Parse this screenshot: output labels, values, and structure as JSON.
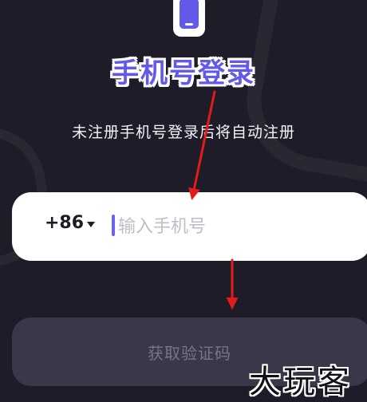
{
  "header": {
    "icon": "phone-icon",
    "title": "手机号登录",
    "subtitle": "未注册手机号登录后将自动注册"
  },
  "phone": {
    "country_code": "+86",
    "dropdown_icon": "caret-down-icon",
    "placeholder": "输入手机号",
    "value": ""
  },
  "action": {
    "get_code_label": "获取验证码",
    "enabled": false
  },
  "annotations": {
    "arrow_color": "#e21b1b",
    "arrow_count": 2
  },
  "watermark": {
    "text": "大玩客"
  },
  "colors": {
    "background": "#1f1c29",
    "accent": "#6258ea",
    "input_background": "#ffffff",
    "disabled_button": "#3a3748"
  }
}
